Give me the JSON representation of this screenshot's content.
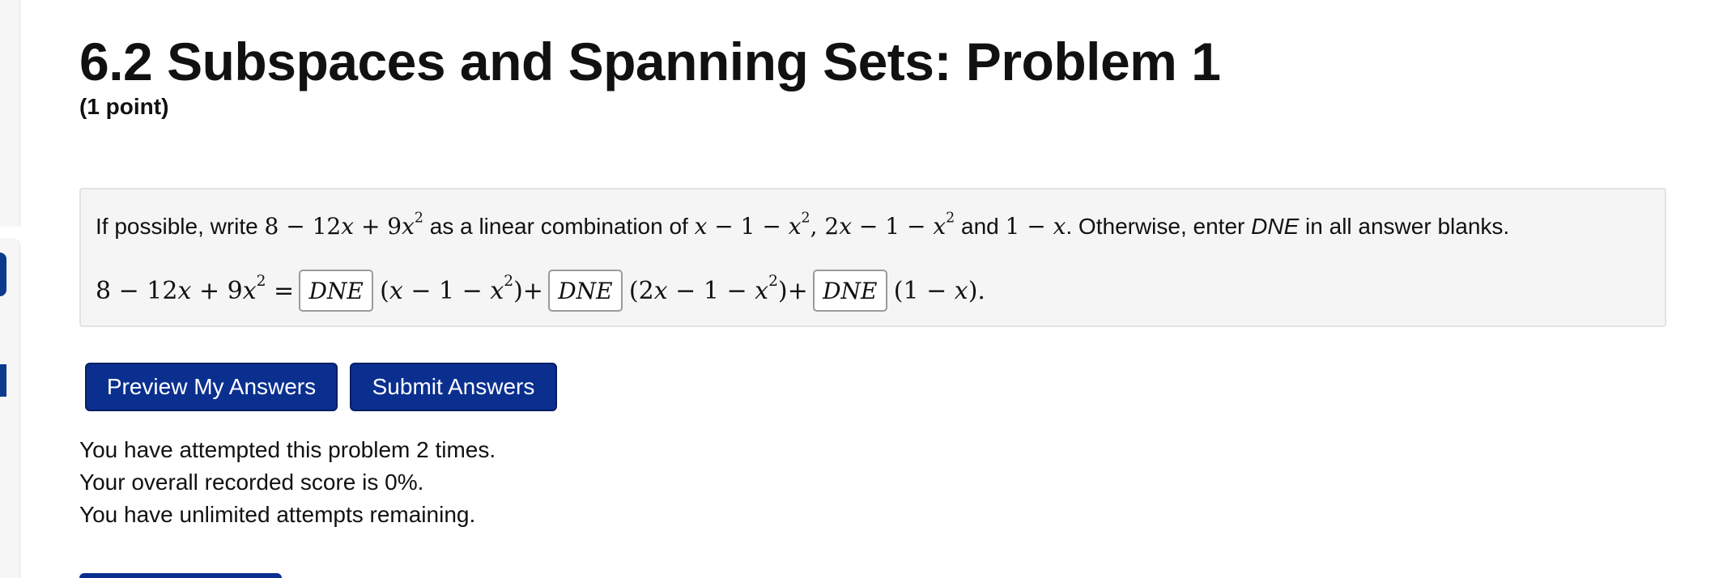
{
  "header": {
    "title": "6.2 Subspaces and Spanning Sets: Problem 1",
    "points": "(1 point)"
  },
  "problem": {
    "intro_prefix": "If possible, write ",
    "intro_mid": " as a linear combination of ",
    "intro_and": " and ",
    "intro_suffix": ". Otherwise, enter ",
    "intro_dne": "DNE",
    "intro_end": " in all answer blanks."
  },
  "answers": {
    "blank1": "DNE",
    "blank2": "DNE",
    "blank3": "DNE"
  },
  "buttons": {
    "preview_label": "Preview My Answers",
    "submit_label": "Submit Answers"
  },
  "status": {
    "attempts": "You have attempted this problem 2 times.",
    "score": "Your overall recorded score is 0%.",
    "remaining": "You have unlimited attempts remaining."
  },
  "colors": {
    "button_bg": "#0a2f8f",
    "problem_box_bg": "#f5f5f5"
  }
}
